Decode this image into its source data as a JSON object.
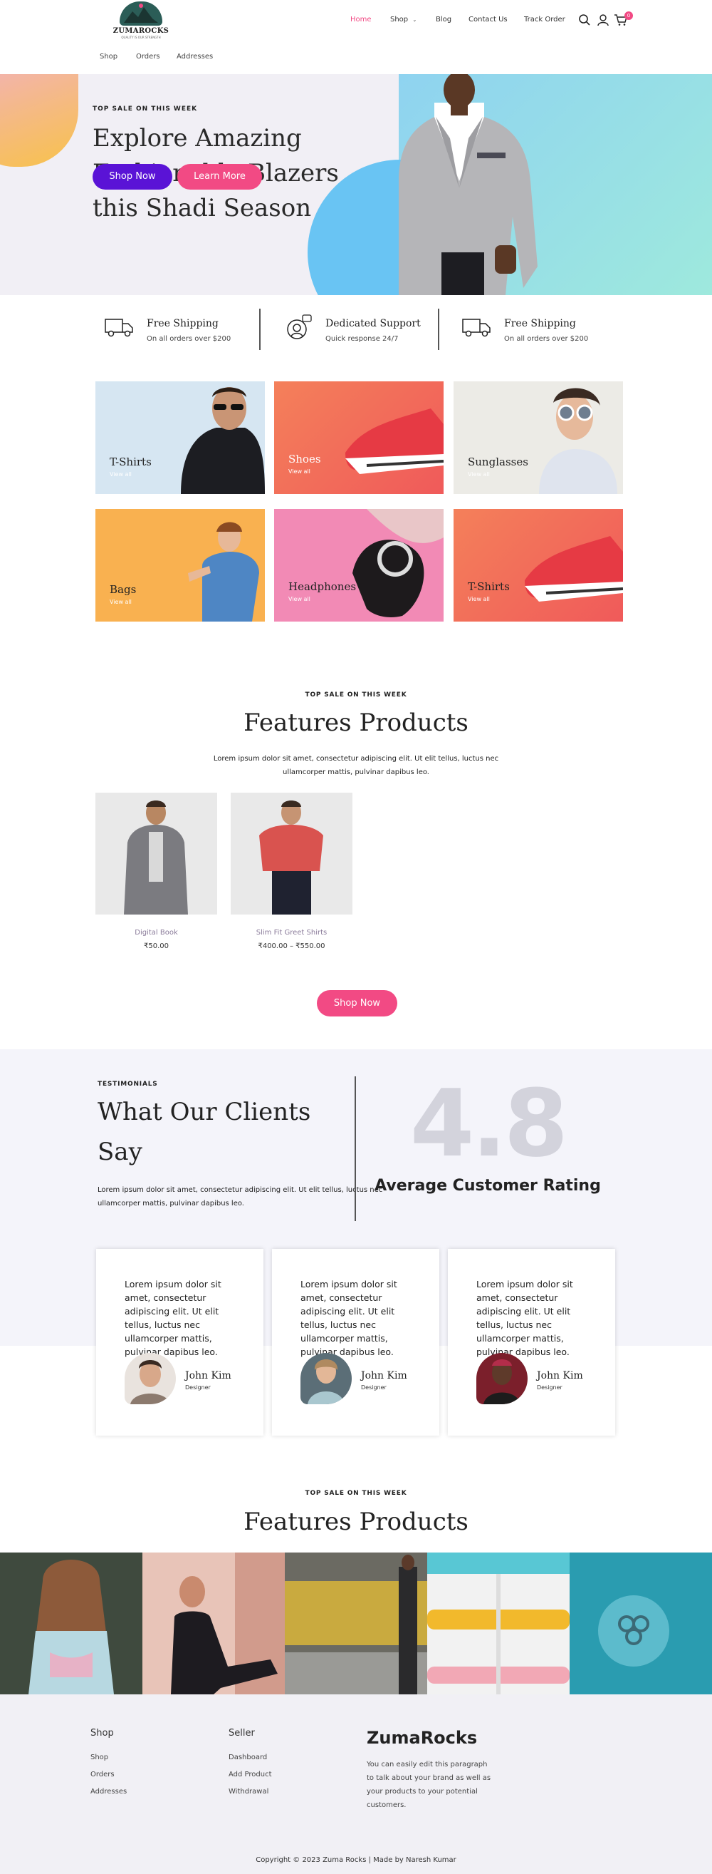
{
  "header": {
    "logo_name": "ZUMAROCKS",
    "logo_tagline": "QUALITY IS OUR STRENGTH",
    "nav": [
      "Home",
      "Shop",
      "Blog",
      "Contact Us",
      "Track Order"
    ],
    "cart_count": "0",
    "subnav": [
      "Shop",
      "Orders",
      "Addresses"
    ],
    "active_color": "#f24a84"
  },
  "hero": {
    "eyebrow": "TOP SALE ON THIS WEEK",
    "headline": "Explore Amazing Fashionable Blazers this Shadi Season",
    "primary_button": "Shop Now",
    "secondary_button": "Learn More"
  },
  "features": [
    {
      "icon": "truck-icon",
      "title": "Free Shipping",
      "subtitle": "On all orders over $200"
    },
    {
      "icon": "support-icon",
      "title": "Dedicated Support",
      "subtitle": "Quick response 24/7"
    },
    {
      "icon": "truck-icon",
      "title": "Free Shipping",
      "subtitle": "On all orders over $200"
    }
  ],
  "categories": [
    {
      "label": "T-Shirts",
      "link": "View all"
    },
    {
      "label": "Shoes",
      "link": "View all"
    },
    {
      "label": "Sunglasses",
      "link": "View all"
    },
    {
      "label": "Bags",
      "link": "View all"
    },
    {
      "label": "Headphones",
      "link": "View all"
    },
    {
      "label": "T-Shirts",
      "link": "View all"
    }
  ],
  "featured1": {
    "eyebrow": "TOP SALE ON THIS WEEK",
    "title": "Features Products",
    "desc_line1": "Lorem ipsum dolor sit amet, consectetur adipiscing elit. Ut elit tellus, luctus nec",
    "desc_line2": "ullamcorper mattis, pulvinar dapibus leo.",
    "products": [
      {
        "name": "Digital Book",
        "price": "₹50.00"
      },
      {
        "name": "Slim Fit Greet Shirts",
        "price": "₹400.00 – ₹550.00"
      }
    ],
    "button": "Shop Now"
  },
  "testimonials": {
    "eyebrow": "TESTIMONIALS",
    "title_line1": "What Our Clients",
    "title_line2": "Say",
    "desc_line1": "Lorem ipsum dolor sit amet, consectetur adipiscing elit. Ut elit tellus, luctus nec",
    "desc_line2": "ullamcorper mattis, pulvinar dapibus leo.",
    "rating": "4.8",
    "rating_label": "Average Customer Rating",
    "cards": [
      {
        "text": "Lorem ipsum dolor sit amet, consectetur adipiscing elit. Ut elit tellus, luctus nec ullamcorper mattis, pulvinar dapibus leo.",
        "name": "John Kim",
        "role": "Designer"
      },
      {
        "text": "Lorem ipsum dolor sit amet, consectetur adipiscing elit. Ut elit tellus, luctus nec ullamcorper mattis, pulvinar dapibus leo.",
        "name": "John Kim",
        "role": "Designer"
      },
      {
        "text": "Lorem ipsum dolor sit amet, consectetur adipiscing elit. Ut elit tellus, luctus nec ullamcorper mattis, pulvinar dapibus leo.",
        "name": "John Kim",
        "role": "Designer"
      }
    ]
  },
  "featured2": {
    "eyebrow": "TOP SALE ON THIS WEEK",
    "title": "Features Products"
  },
  "footer": {
    "col1_title": "Shop",
    "col1_links": [
      "Shop",
      "Orders",
      "Addresses"
    ],
    "col2_title": "Seller",
    "col2_links": [
      "Dashboard",
      "Add Product",
      "Withdrawal"
    ],
    "brand": "ZumaRocks",
    "brand_desc": "You can easily edit this paragraph to talk about your brand as well as your products to your potential customers.",
    "copyright": "Copyright © 2023 Zuma Rocks | Made by Naresh Kumar"
  }
}
